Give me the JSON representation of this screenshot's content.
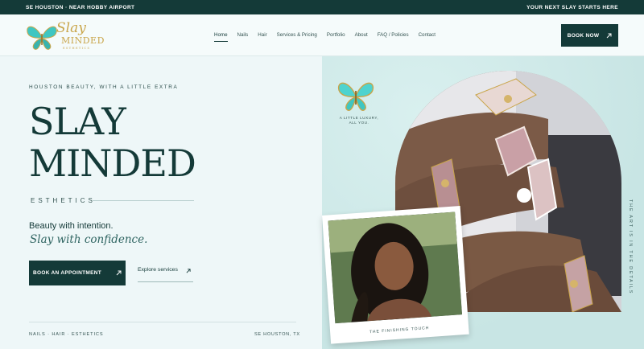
{
  "topbar": {
    "left": "SE HOUSTON · NEAR HOBBY AIRPORT",
    "right": "YOUR NEXT SLAY STARTS HERE"
  },
  "brand": {
    "line1": "Slay",
    "line2": "MINDED",
    "line3": "ESTHETICS"
  },
  "nav": {
    "items": [
      {
        "label": "Home",
        "active": true
      },
      {
        "label": "Nails"
      },
      {
        "label": "Hair"
      },
      {
        "label": "Services & Pricing"
      },
      {
        "label": "Portfolio"
      },
      {
        "label": "About"
      },
      {
        "label": "FAQ / Policies"
      },
      {
        "label": "Contact"
      }
    ],
    "book_label": "BOOK NOW",
    "book_icon": "arrow-up-right-icon"
  },
  "hero": {
    "eyebrow": "HOUSTON BEAUTY, WITH A LITTLE EXTRA",
    "title_line1": "SLAY",
    "title_line2": "MINDED",
    "subtitle": "ESTHETICS",
    "tagline1": "Beauty with intention.",
    "tagline2": "Slay with confidence.",
    "cta_primary": "BOOK AN APPOINTMENT",
    "cta_secondary": "Explore services",
    "footer_left": "NAILS · HAIR · ESTHETICS",
    "footer_right": "SE HOUSTON, TX"
  },
  "visual": {
    "badge_text1": "A LITTLE LUXURY,",
    "badge_text2": "ALL YOU.",
    "vertical_text": "THE ART IS IN THE DETAILS",
    "polaroid_caption": "THE FINISHING TOUCH"
  },
  "colors": {
    "primary": "#143a38",
    "accent_gold": "#c9a54a",
    "turquoise": "#3fc6c2",
    "bg_light": "#eef7f8",
    "bg_teal": "#cfeaea"
  }
}
